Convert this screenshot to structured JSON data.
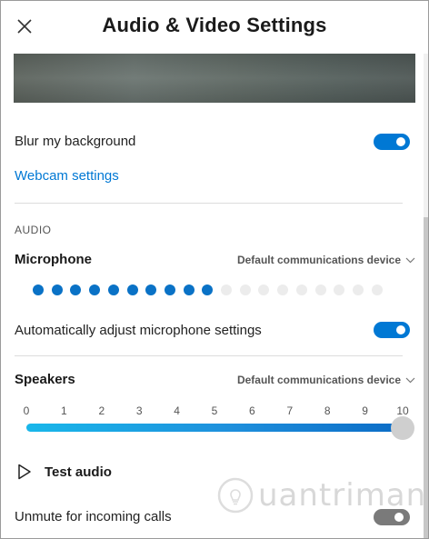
{
  "header": {
    "title": "Audio & Video Settings"
  },
  "video": {
    "blur_label": "Blur my background",
    "blur_on": true,
    "webcam_link": "Webcam settings"
  },
  "audio": {
    "section_label": "AUDIO",
    "microphone": {
      "label": "Microphone",
      "device": "Default communications device",
      "level_dots_total": 19,
      "level_dots_active": 10
    },
    "auto_adjust": {
      "label": "Automatically adjust microphone settings",
      "on": true
    },
    "speakers": {
      "label": "Speakers",
      "device": "Default communications device",
      "ticks": [
        "0",
        "1",
        "2",
        "3",
        "4",
        "5",
        "6",
        "7",
        "8",
        "9",
        "10"
      ],
      "volume": 10,
      "volume_max": 10
    },
    "test_audio_label": "Test audio",
    "unmute": {
      "label": "Unmute for incoming calls",
      "on": false
    }
  },
  "watermark": {
    "text": "uantrimang"
  },
  "colors": {
    "accent": "#0078d4",
    "dot_active": "#0a72c6",
    "dot_inactive": "#ececec"
  },
  "icons": {
    "close": "close-icon",
    "chevron": "chevron-down-icon",
    "play": "play-icon"
  }
}
